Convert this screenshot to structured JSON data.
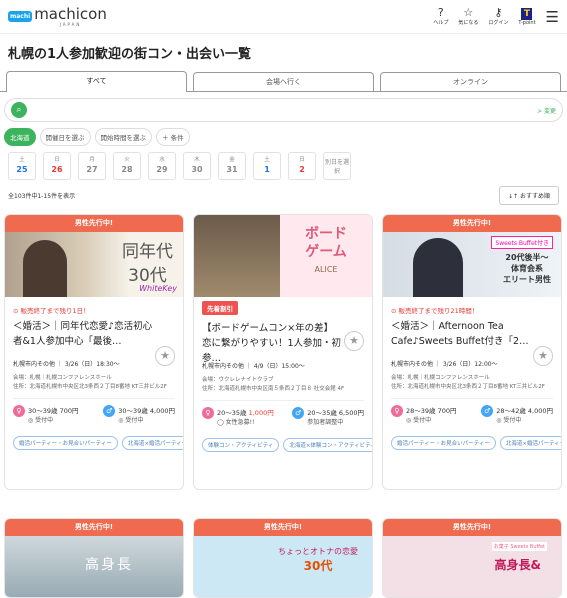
{
  "header": {
    "logo_badge": "machi",
    "logo_text": "machicon",
    "logo_sub": "JAPAN",
    "help": "ヘルプ",
    "fav": "気になる",
    "login": "ログイン",
    "tcard": "T",
    "tcard_label": "T-point"
  },
  "page_title": "札幌の1人参加歓迎の街コン・出会い一覧",
  "tabs": [
    "すべて",
    "会場へ行く",
    "オンライン"
  ],
  "search": {
    "placeholder": "",
    "change": "> 変更"
  },
  "filters": [
    "北海道",
    "開催日を選ぶ",
    "開始時間を選ぶ",
    "＋ 条件"
  ],
  "dates": [
    {
      "dow": "土",
      "day": "25",
      "kind": "sat"
    },
    {
      "dow": "日",
      "day": "26",
      "kind": "sun"
    },
    {
      "dow": "月",
      "day": "27",
      "kind": ""
    },
    {
      "dow": "火",
      "day": "28",
      "kind": ""
    },
    {
      "dow": "水",
      "day": "29",
      "kind": ""
    },
    {
      "dow": "木",
      "day": "30",
      "kind": ""
    },
    {
      "dow": "金",
      "day": "31",
      "kind": ""
    },
    {
      "dow": "土",
      "day": "1",
      "kind": "sat"
    },
    {
      "dow": "日",
      "day": "2",
      "kind": "sun"
    }
  ],
  "date_other": "別日を選択",
  "result_count": "全103件中1-15件を表示",
  "sort_label": "↓↑ おすすめ順",
  "cards": [
    {
      "band": "男性先行中!",
      "img_text": "同年代\n30代",
      "img_brand": "WhiteKey",
      "tag": "",
      "deadline": "⊙ 販売終了まで残り1日！",
      "title": "＜婚活＞｜同年代恋愛♪恋活初心者&1人参加中心「最後…",
      "meta": "札幌市内その他 ｜ 3/26（日）18:30～",
      "venue": "会場：札幌｜札幌コンファレンスホール\n住所：北海道札幌市中央区北3条西２丁目8番地 KT三井ビル2F",
      "f_price": "30～39歳 700円",
      "f_status": "◎ 受付中",
      "m_price": "30～39歳 4,000円",
      "m_status": "◎ 受付中",
      "tags": [
        "婚活パーティー・お見合いパーティー",
        "北海道×婚活パーティー"
      ]
    },
    {
      "band": "",
      "img_text": "ボード\nゲーム",
      "img_brand": "ALICE",
      "tag": "先着割引",
      "deadline": "",
      "title": "【ボードゲームコン×年の差】恋に繋がりやすい！1人参加・初参…",
      "meta": "札幌市内その他 ｜ 4/9（日）15:00～",
      "venue": "会場：ウクレレナイトクラブ\n住所：北海道札幌市中央区南５条西２丁目８ 社交会館 4F",
      "f_price": "20～35歳 ",
      "f_price_red": "1,000円",
      "f_status": "◯ 女性急募!!",
      "m_price": "20～35歳 6,500円",
      "m_status": "参加者調整中",
      "tags": [
        "体験コン・アクティビティ",
        "北海道×体験コン・アクティビティ"
      ]
    },
    {
      "band": "男性先行中!",
      "img_text": "20代後半～\n体育会系\nエリート男性",
      "img_brand": "Sweets Buffet付き",
      "tag": "",
      "deadline": "⊙ 販売終了まで残り21時間！",
      "title": "＜婚活＞｜Afternoon Tea Cafe♪Sweets Buffet付き「2…",
      "meta": "札幌市内その他 ｜ 3/26（日）12:00～",
      "venue": "会場：札幌｜札幌コンファレンスホール\n住所：北海道札幌市中央区北3条西２丁目8番地 KT三井ビル2F",
      "f_price": "28～39歳 700円",
      "f_status": "◎ 受付中",
      "m_price": "28～42歳 4,000円",
      "m_status": "◎ 受付中",
      "tags": [
        "婚活パーティー・お見合いパーティー",
        "北海道×婚活パーティー"
      ]
    }
  ],
  "row2": [
    {
      "band": "",
      "text": "高身長"
    },
    {
      "band": "男性先行中!",
      "text1": "ちょっとオトナの恋愛",
      "text2": "30代"
    },
    {
      "band": "男性先行中!",
      "text": "高身長&",
      "sb": "お菓子 Sweets Buffet"
    }
  ]
}
